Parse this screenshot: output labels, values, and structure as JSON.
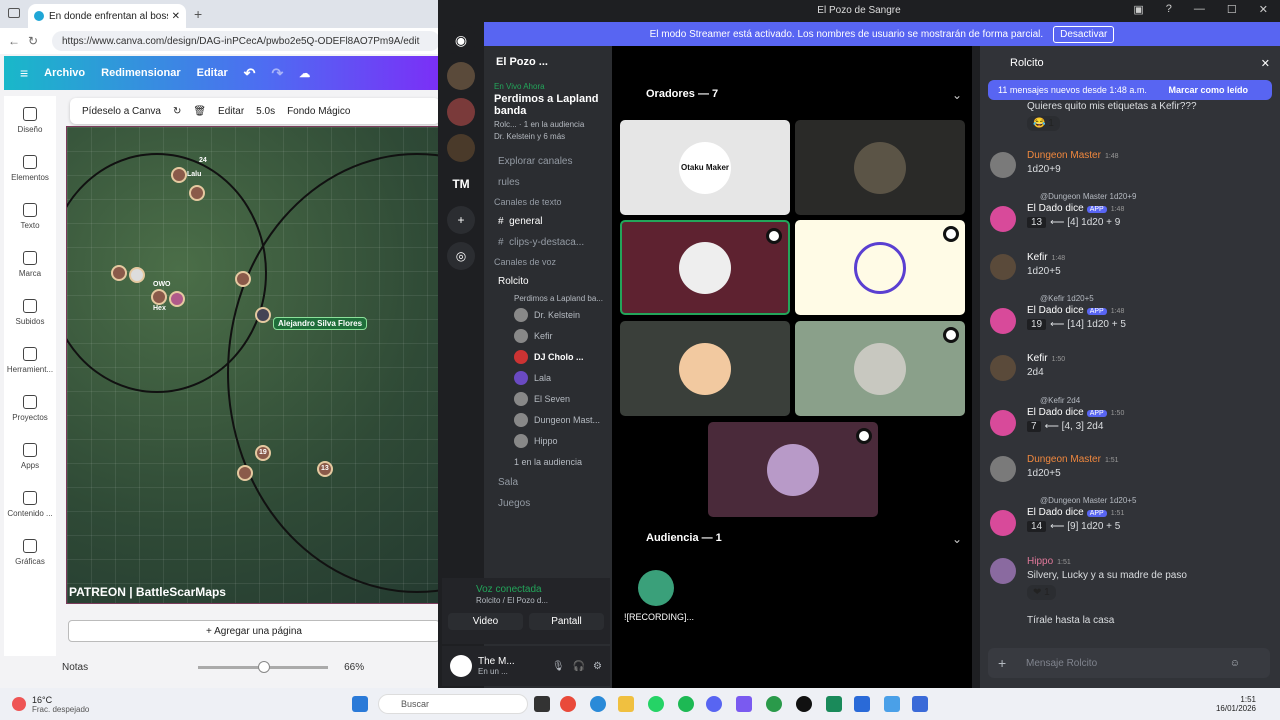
{
  "browser": {
    "tab_title": "En donde enfrentan al boss y al cr",
    "url": "https://www.canva.com/design/DAG-inPCecA/pwbo2e5Q-ODEFl8AO7Pm9A/edit"
  },
  "canva": {
    "menu": [
      "Archivo",
      "Redimensionar",
      "Editar"
    ],
    "rail": [
      "Diseño",
      "Elementos",
      "Texto",
      "Marca",
      "Subidos",
      "Herramient...",
      "Proyectos",
      "Apps",
      "Contenido ...",
      "Gráficas"
    ],
    "ctx": [
      "Pídeselo a Canva",
      "Editar",
      "5.0s",
      "Fondo Mágico"
    ],
    "tokens": {
      "t24": "24",
      "lalu": "Lalu",
      "owo": "OWO",
      "hex": "Hex",
      "t19": "19",
      "t13": "13"
    },
    "player_tag": "Alejandro Silva Flores",
    "watermark": "PATREON | BattleScarMaps",
    "add_page": "+ Agregar una página",
    "notes": "Notas",
    "zoom": "66%"
  },
  "discord": {
    "window_title": "El Pozo de Sangre",
    "streamer_banner": "El modo Streamer está activado. Los nombres de usuario se mostrarán de forma parcial.",
    "streamer_button": "Desactivar",
    "server_initials": "TM",
    "server_name": "El Pozo ...",
    "live": {
      "tag": "En Vivo Ahora",
      "title": "Perdimos a Lapland banda",
      "sub1": "Rolc...",
      "sub2": "1 en la audiencia",
      "sub3": "Dr. Kelstein y 6 más"
    },
    "explore": "Explorar canales",
    "rules": "rules",
    "cat_text": "Canales de texto",
    "ch_general": "general",
    "ch_clips": "clips-y-destaca...",
    "cat_voice": "Canales de voz",
    "voice_channel": "Rolcito",
    "voice_sub": "Perdimos a Lapland ba...",
    "voice_users": [
      "Dr. Kelstein",
      "Kefir",
      "DJ Cholo ...",
      "Lala",
      "El Seven",
      "Dungeon Mast...",
      "Hippo"
    ],
    "audience_line": "1 en la audiencia",
    "ch_sala": "Sala",
    "ch_juegos": "Juegos",
    "voice_connected": "Voz conectada",
    "voice_conn_sub": "Rolcito / El Pozo d...",
    "btn_video": "Video",
    "btn_screen": "Pantall",
    "user_name": "The M...",
    "user_status": "En un ...",
    "speakers_header": "Oradores — 7",
    "tile_logo": "Otaku Maker",
    "audience_header": "Audiencia — 1",
    "audience_name": "![RECORDING]...",
    "chat_title": "Rolcito",
    "new_msgs": "11 mensajes nuevos desde 1:48 a.m.",
    "mark_read": "Marcar como leído",
    "partial_msg": "Quieres quito mis etiquetas a Kefir???",
    "msgs": {
      "dm1_name": "Dungeon Master",
      "dm1_time": "1:48",
      "dm1_text": "1d20+9",
      "d1_rep": "@Dungeon Master 1d20+9",
      "dado_name": "El Dado dice",
      "app": "APP",
      "d1_time": "1:48",
      "d1_num": "13",
      "d1_text": "⟵ [4] 1d20 + 9",
      "k1_name": "Kefir",
      "k1_time": "1:48",
      "k1_text": "1d20+5",
      "d2_rep": "@Kefir 1d20+5",
      "d2_time": "1:48",
      "d2_num": "19",
      "d2_text": "⟵ [14] 1d20 + 5",
      "k2_name": "Kefir",
      "k2_time": "1:50",
      "k2_text": "2d4",
      "d3_rep": "@Kefir 2d4",
      "d3_time": "1:50",
      "d3_num": "7",
      "d3_text": "⟵ [4, 3] 2d4",
      "dm2_name": "Dungeon Master",
      "dm2_time": "1:51",
      "dm2_text": "1d20+5",
      "d4_rep": "@Dungeon Master 1d20+5",
      "d4_time": "1:51",
      "d4_num": "14",
      "d4_text": "⟵ [9] 1d20 + 5",
      "h_name": "Hippo",
      "h_time": "1:51",
      "h_text": "Silvery, Lucky y a su madre de paso",
      "last_text": "Tírale hasta la casa",
      "react_count": "1"
    },
    "chat_placeholder": "Mensaje Rolcito"
  },
  "taskbar": {
    "weather_temp": "16°C",
    "weather_desc": "Frac. despejado",
    "search": "Buscar",
    "time": "1:51",
    "date": "16/01/2026"
  }
}
